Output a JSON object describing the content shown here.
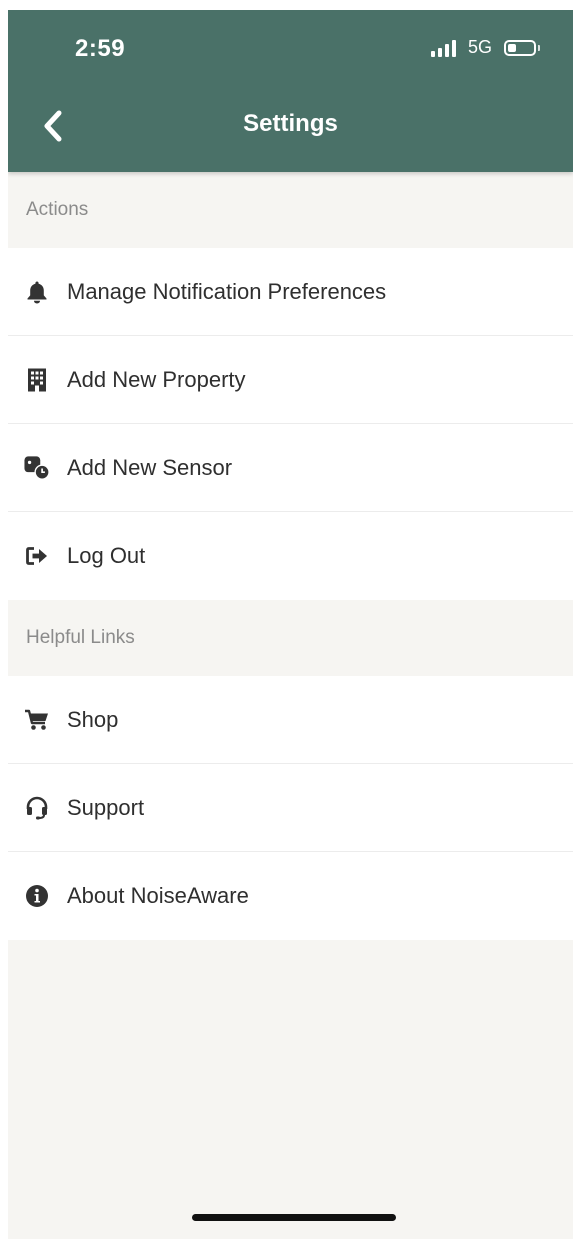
{
  "status_bar": {
    "time": "2:59",
    "network": "5G",
    "battery_level_percent": 35
  },
  "header": {
    "title": "Settings",
    "back_icon": "chevron-left-icon",
    "background_color": "#4a7168"
  },
  "sections": {
    "actions": {
      "title": "Actions",
      "items": [
        {
          "label": "Manage Notification Preferences",
          "icon": "bell-icon"
        },
        {
          "label": "Add New Property",
          "icon": "building-icon"
        },
        {
          "label": "Add New Sensor",
          "icon": "sensor-icon"
        },
        {
          "label": "Log Out",
          "icon": "sign-out-icon"
        }
      ]
    },
    "helpful_links": {
      "title": "Helpful Links",
      "items": [
        {
          "label": "Shop",
          "icon": "cart-icon"
        },
        {
          "label": "Support",
          "icon": "headset-icon"
        },
        {
          "label": "About NoiseAware",
          "icon": "info-circle-icon"
        }
      ]
    }
  }
}
